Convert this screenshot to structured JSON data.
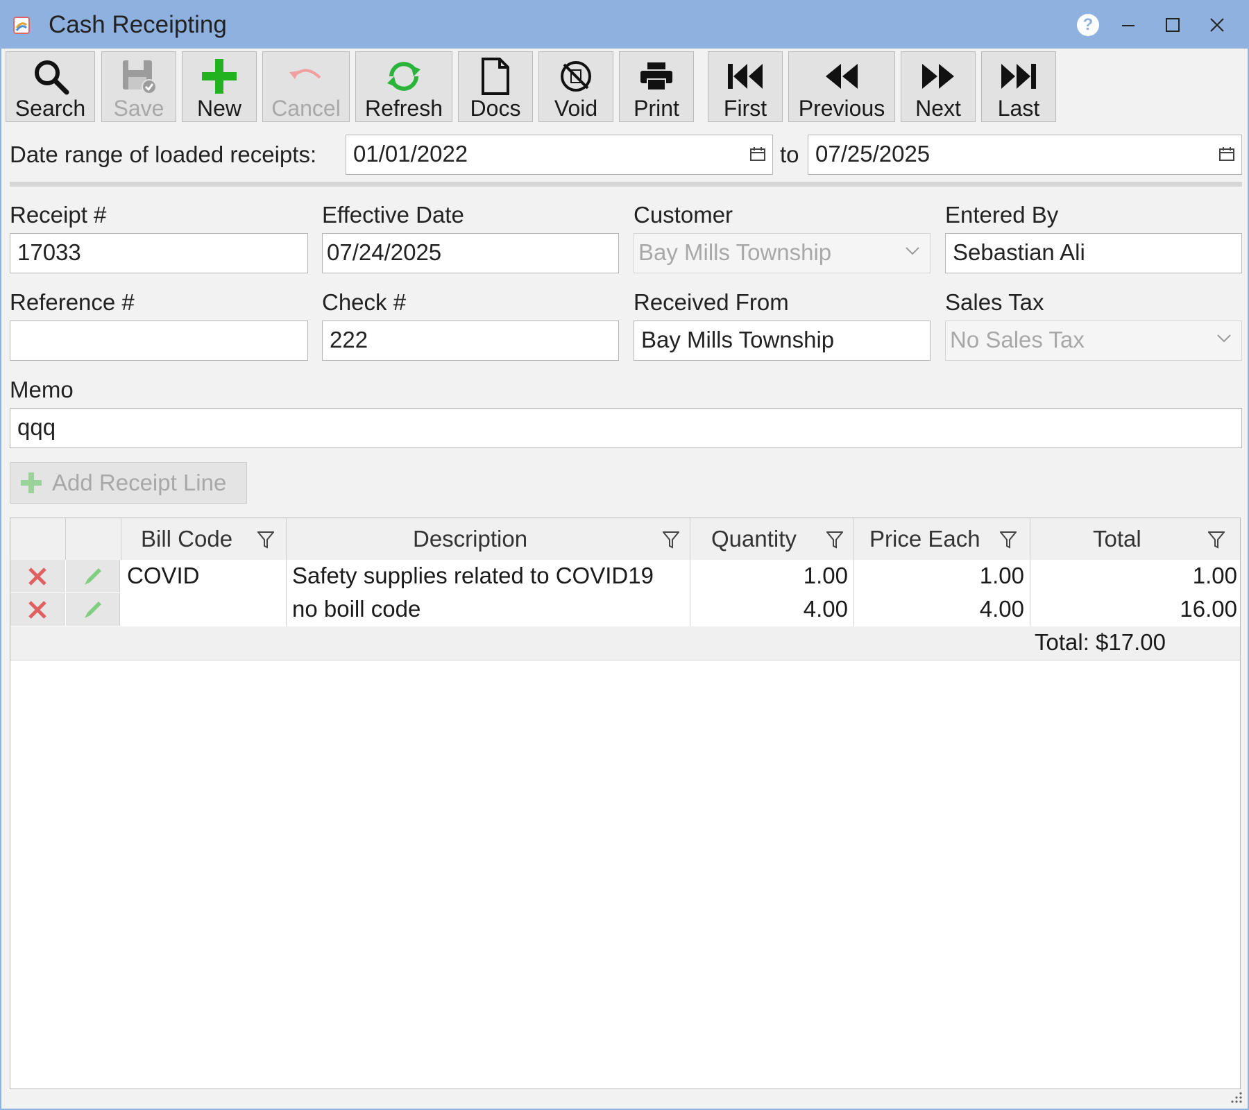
{
  "window": {
    "title": "Cash Receipting"
  },
  "toolbar": {
    "search": "Search",
    "save": "Save",
    "new": "New",
    "cancel": "Cancel",
    "refresh": "Refresh",
    "docs": "Docs",
    "void": "Void",
    "print": "Print",
    "first": "First",
    "previous": "Previous",
    "next": "Next",
    "last": "Last"
  },
  "date_range": {
    "label": "Date range of loaded receipts:",
    "from": "01/01/2022",
    "to_label": "to",
    "to": "07/25/2025"
  },
  "form": {
    "receipt_label": "Receipt #",
    "receipt_value": "17033",
    "effective_date_label": "Effective Date",
    "effective_date_value": "07/24/2025",
    "customer_label": "Customer",
    "customer_value": "Bay Mills Township",
    "entered_by_label": "Entered By",
    "entered_by_value": "Sebastian Ali",
    "reference_label": "Reference #",
    "reference_value": "",
    "check_label": "Check #",
    "check_value": "222",
    "received_from_label": "Received From",
    "received_from_value": "Bay Mills Township",
    "sales_tax_label": "Sales Tax",
    "sales_tax_value": "No Sales Tax",
    "memo_label": "Memo",
    "memo_value": "qqq"
  },
  "add_line": {
    "label": "Add Receipt Line"
  },
  "grid": {
    "columns": [
      "Bill Code",
      "Description",
      "Quantity",
      "Price Each",
      "Total"
    ],
    "rows": [
      {
        "bill_code": "COVID",
        "description": "Safety supplies related to COVID19",
        "quantity": "1.00",
        "price_each": "1.00",
        "total": "1.00"
      },
      {
        "bill_code": "",
        "description": "no boill code",
        "quantity": "4.00",
        "price_each": "4.00",
        "total": "16.00"
      }
    ],
    "footer_total": "Total: $17.00"
  },
  "colors": {
    "titlebar": "#8fb1df",
    "new_icon": "#22b21f",
    "refresh_icon": "#2ab53a",
    "delete_icon": "#e06060",
    "edit_icon": "#7fcf7f"
  }
}
